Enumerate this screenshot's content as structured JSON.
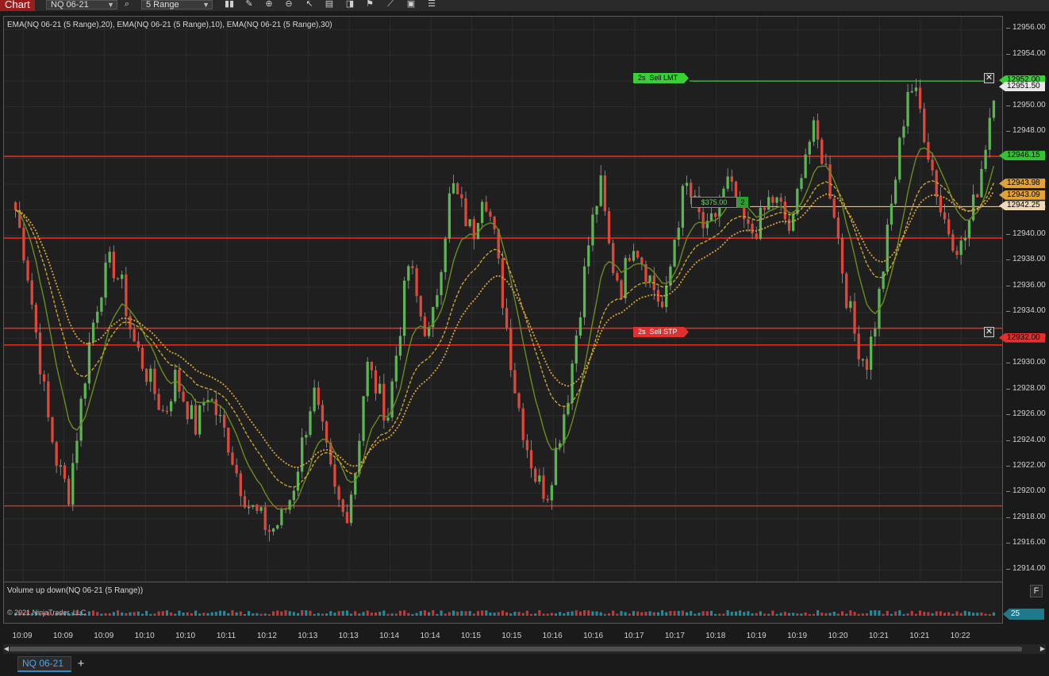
{
  "toolbar": {
    "tab_label": "Chart",
    "instrument_value": "NQ 06-21",
    "period_value": "5 Range",
    "icons": [
      "search-icon",
      "bar-type-icon",
      "pencil-icon",
      "zoom-in-icon",
      "zoom-out-icon",
      "cursor-icon",
      "data-box-icon",
      "templates-icon",
      "strategy-icon",
      "drawing-tools-icon",
      "properties-icon",
      "more-icon"
    ]
  },
  "chart": {
    "indicator_label": "EMA(NQ 06-21 (5 Range),20), EMA(NQ 06-21 (5 Range),10), EMA(NQ 06-21 (5 Range),30)",
    "price_ticks": [
      "12956.00",
      "12954.00",
      "12952.00",
      "12950.00",
      "12948.00",
      "12946.00",
      "12944.00",
      "12942.00",
      "12940.00",
      "12938.00",
      "12936.00",
      "12934.00",
      "12932.00",
      "12930.00",
      "12928.00",
      "12926.00",
      "12924.00",
      "12922.00",
      "12920.00",
      "12918.00",
      "12916.00",
      "12914.00"
    ],
    "y_range": [
      12913,
      12957
    ],
    "time_ticks": [
      "10:09",
      "10:09",
      "10:09",
      "10:10",
      "10:10",
      "10:11",
      "10:12",
      "10:13",
      "10:13",
      "10:14",
      "10:14",
      "10:15",
      "10:15",
      "10:16",
      "10:16",
      "10:17",
      "10:17",
      "10:18",
      "10:19",
      "10:19",
      "10:20",
      "10:21",
      "10:21",
      "10:22"
    ],
    "horizontal_lines": [
      12946.15,
      12939.8,
      12932.8,
      12931.5,
      12919.0
    ],
    "price_flags": [
      {
        "value": "12952.00",
        "price": 12952.0,
        "color": "#37d037"
      },
      {
        "value": "12951.50",
        "price": 12951.5,
        "color": "#e8e8e8"
      },
      {
        "value": "12946.15",
        "price": 12946.15,
        "color": "#35c235"
      },
      {
        "value": "12943.98",
        "price": 12943.98,
        "color": "#e0a33a"
      },
      {
        "value": "12943.09",
        "price": 12943.09,
        "color": "#e0a33a"
      },
      {
        "value": "12942.25",
        "price": 12942.25,
        "color": "#f0d9b8"
      },
      {
        "value": "12932.00",
        "price": 12932.0,
        "color": "#e03030"
      }
    ],
    "orders": {
      "sell_limit": {
        "qty": "2s",
        "label": "Sell LMT",
        "price": 12952.0
      },
      "sell_stop": {
        "qty": "2s",
        "label": "Sell STP",
        "price": 12932.0
      }
    },
    "position": {
      "pnl": "$375.00",
      "qty": "2",
      "price": 12942.25
    },
    "close_icon": "✕",
    "colors": {
      "up": "#5ab552",
      "down": "#e0473b",
      "line": "#e12a1f",
      "ema_fast": "#6b8c1f",
      "ema_mid": "#c9a52b",
      "ema_slow": "#d9a23a"
    }
  },
  "volume_panel": {
    "label": "Volume up down(NQ 06-21 (5 Range))",
    "copyright": "© 2021 NinjaTrader, LLC",
    "value": "25",
    "f_label": "F"
  },
  "tabs": {
    "instrument": "NQ 06-21",
    "add": "+"
  },
  "chart_data": {
    "type": "line",
    "series": [
      {
        "name": "NQ 06-21 (5 Range)",
        "values": [
          12942,
          12938,
          12932,
          12926,
          12922,
          12920,
          12926,
          12932,
          12936,
          12938,
          12936,
          12932,
          12930,
          12928,
          12926,
          12929,
          12927,
          12925,
          12928,
          12926,
          12924,
          12921,
          12919,
          12918,
          12917,
          12918,
          12920,
          12924,
          12928,
          12924,
          12920,
          12918,
          12922,
          12930,
          12928,
          12926,
          12932,
          12938,
          12934,
          12932,
          12938,
          12944,
          12942,
          12940,
          12944,
          12940,
          12934,
          12928,
          12924,
          12921,
          12920,
          12924,
          12928,
          12934,
          12940,
          12944,
          12938,
          12936,
          12940,
          12938,
          12936,
          12934,
          12940,
          12944,
          12942,
          12940,
          12942,
          12944,
          12942,
          12940,
          12941,
          12943,
          12942,
          12940,
          12946,
          12948,
          12946,
          12942,
          12936,
          12932,
          12930,
          12934,
          12940,
          12946,
          12952,
          12950,
          12946,
          12942,
          12940,
          12939,
          12942,
          12946,
          12951.5
        ]
      }
    ],
    "ylim": [
      12913,
      12957
    ]
  }
}
